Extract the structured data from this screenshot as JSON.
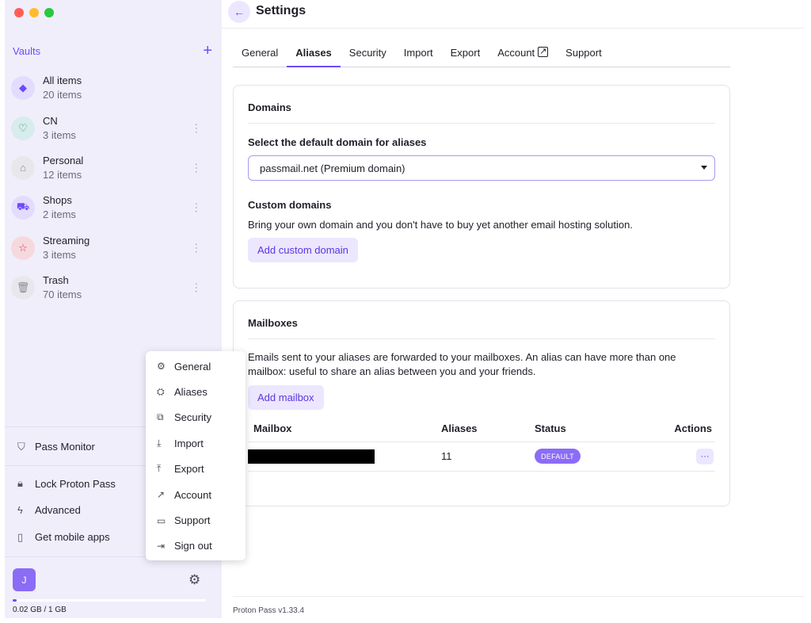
{
  "window": {
    "title": "Settings"
  },
  "sidebar": {
    "vaults_title": "Vaults",
    "add_icon": "+",
    "vaults": [
      {
        "name": "All items",
        "count": "20 items",
        "icon": "diamond-icon",
        "glyph": "◆",
        "bg": "#e3dcff",
        "fg": "#6d4aff"
      },
      {
        "name": "CN",
        "count": "3 items",
        "icon": "heart-icon",
        "glyph": "♡",
        "bg": "#d7ecec",
        "fg": "#2e8b8b"
      },
      {
        "name": "Personal",
        "count": "12 items",
        "icon": "home-icon",
        "glyph": "⌂",
        "bg": "#e8e8ec",
        "fg": "#8a8a95"
      },
      {
        "name": "Shops",
        "count": "2 items",
        "icon": "cart-icon",
        "glyph": "⛟",
        "bg": "#e3dcff",
        "fg": "#6d4aff"
      },
      {
        "name": "Streaming",
        "count": "3 items",
        "icon": "star-icon",
        "glyph": "☆",
        "bg": "#f6d9de",
        "fg": "#d8394f"
      },
      {
        "name": "Trash",
        "count": "70 items",
        "icon": "trash-icon",
        "glyph": "🗑",
        "bg": "#e8e8ec",
        "fg": "#8a8a95"
      }
    ],
    "bottom_items": [
      {
        "label": "Pass Monitor",
        "icon": "shield-check-icon",
        "glyph": "⛉"
      },
      {
        "label": "Lock Proton Pass",
        "icon": "lock-icon",
        "glyph": "🔒︎"
      },
      {
        "label": "Advanced",
        "icon": "bolt-icon",
        "glyph": "ϟ"
      },
      {
        "label": "Get mobile apps",
        "icon": "phone-icon",
        "glyph": "▯"
      }
    ],
    "user": {
      "initial": "J",
      "storage": "0.02 GB / 1 GB",
      "storage_fraction": 0.02
    }
  },
  "main": {
    "title": "Settings",
    "tabs": [
      "General",
      "Aliases",
      "Security",
      "Import",
      "Export",
      "Account",
      "Support"
    ],
    "active_tab": "Aliases",
    "domains": {
      "title": "Domains",
      "select_label": "Select the default domain for aliases",
      "selected_domain": "passmail.net (Premium domain)",
      "custom_title": "Custom domains",
      "custom_desc": "Bring your own domain and you don't have to buy yet another email hosting solution.",
      "add_button": "Add custom domain"
    },
    "mailboxes": {
      "title": "Mailboxes",
      "desc_line1": "Emails sent to your aliases are forwarded to your mailboxes. An alias can have more than one",
      "desc_line2": "mailbox: useful to share an alias between you and your friends.",
      "add_button": "Add mailbox",
      "columns": [
        "Mailbox",
        "Aliases",
        "Status",
        "Actions"
      ],
      "rows": [
        {
          "mailbox": "",
          "aliases": "11",
          "status": "DEFAULT",
          "actions": "···"
        }
      ]
    },
    "version": "Proton Pass v1.33.4"
  },
  "popup_menu": {
    "items": [
      {
        "label": "General",
        "icon": "gear-icon",
        "glyph": "⚙"
      },
      {
        "label": "Aliases",
        "icon": "alias-icon",
        "glyph": "⛭"
      },
      {
        "label": "Security",
        "icon": "security-icon",
        "glyph": "⧉"
      },
      {
        "label": "Import",
        "icon": "import-icon",
        "glyph": "⤓"
      },
      {
        "label": "Export",
        "icon": "export-icon",
        "glyph": "⤒"
      },
      {
        "label": "Account",
        "icon": "external-link-icon",
        "glyph": "↗"
      },
      {
        "label": "Support",
        "icon": "chat-icon",
        "glyph": "▭"
      },
      {
        "label": "Sign out",
        "icon": "sign-out-icon",
        "glyph": "⇥"
      }
    ]
  },
  "colors": {
    "accent": "#6d4aff",
    "sidebar_bg": "#f1eefb",
    "badge": "#8b6cf6"
  }
}
